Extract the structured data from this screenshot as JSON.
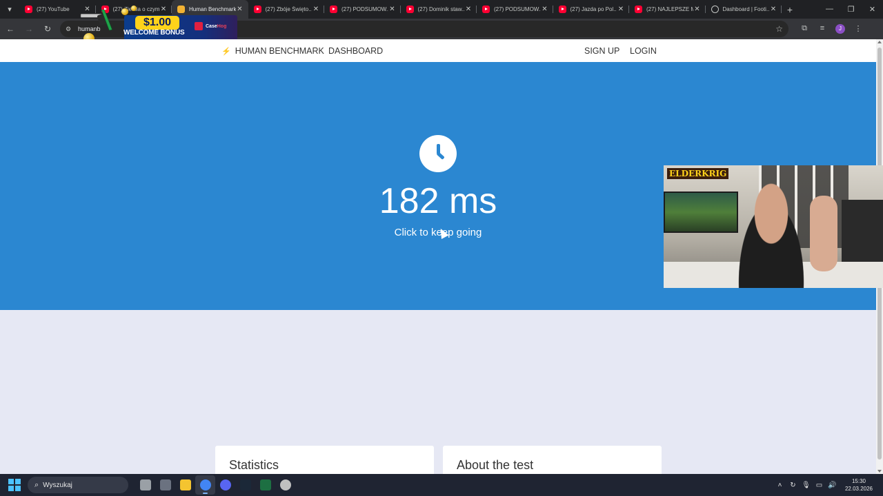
{
  "browser": {
    "tabs": [
      {
        "title": "(27) YouTube",
        "icon": "youtube-icon"
      },
      {
        "title": "(27) Ziemia o czym...",
        "icon": "youtube-icon"
      },
      {
        "title": "Human Benchmark",
        "icon": "human-benchmark-icon",
        "active": true
      },
      {
        "title": "(27) Zbóje Święto...",
        "icon": "youtube-icon"
      },
      {
        "title": "(27) PODSUMOW...",
        "icon": "youtube-icon"
      },
      {
        "title": "(27) Dominik staw...",
        "icon": "youtube-icon"
      },
      {
        "title": "(27) PODSUMOW...",
        "icon": "youtube-icon"
      },
      {
        "title": "(27) Jazda po Pol...",
        "icon": "youtube-icon"
      },
      {
        "title": "(27) NAJLEPSZE M...",
        "icon": "youtube-icon"
      },
      {
        "title": "Dashboard | Footi...",
        "icon": "globe-icon"
      }
    ],
    "url": "humanb",
    "profile_initial": "J"
  },
  "promo": {
    "amount": "$1.00",
    "text": "WELCOME BONUS",
    "brand_a": "Case",
    "brand_b": "Hog"
  },
  "site": {
    "logo": "HUMAN BENCHMARK",
    "nav": [
      "DASHBOARD"
    ],
    "auth": {
      "signup": "SIGN UP",
      "login": "LOGIN"
    }
  },
  "test": {
    "result": "182 ms",
    "prompt": "Click to keep going"
  },
  "cards": [
    {
      "title": "Statistics"
    },
    {
      "title": "About the test"
    }
  ],
  "webcam": {
    "overlay_logo": "ELDERKRIG"
  },
  "taskbar": {
    "search_placeholder": "Wyszukaj",
    "time": "15:30",
    "date": "22.03.2026",
    "apps": [
      "file-explorer-icon",
      "task-view-icon",
      "folder-icon",
      "chrome-icon",
      "discord-icon",
      "steam-icon",
      "excel-icon",
      "app-icon"
    ]
  },
  "colors": {
    "hero_blue": "#2b87d1",
    "page_bg": "#e6e8f4",
    "tab_bar": "#202124",
    "toolbar": "#35363a",
    "taskbar": "#1f2432",
    "promo_yellow": "#ffd31a"
  }
}
